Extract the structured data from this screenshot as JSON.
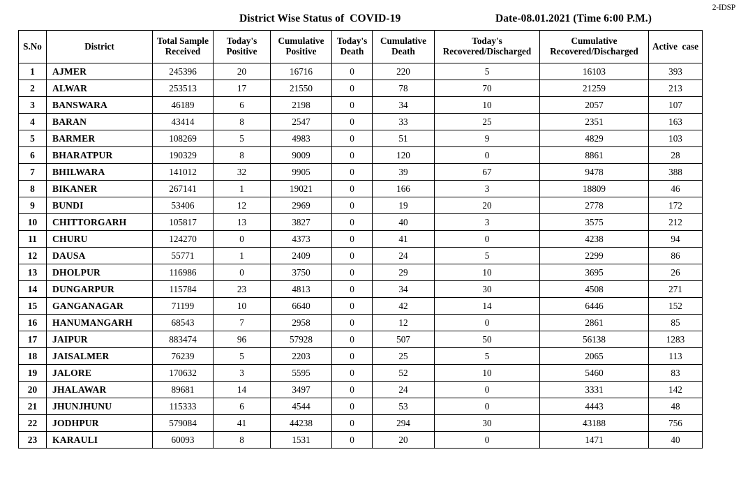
{
  "document": {
    "corner_stamp": "2-IDSP",
    "title": "District Wise Status of  COVID-19",
    "date_line": "Date-08.01.2021 (Time 6:00 P.M.)"
  },
  "table": {
    "columns": [
      {
        "key": "sno",
        "label": "S.No"
      },
      {
        "key": "district",
        "label": "District"
      },
      {
        "key": "total_sample_received",
        "label": "Total Sample\nReceived"
      },
      {
        "key": "todays_positive",
        "label": "Today's\nPositive"
      },
      {
        "key": "cumulative_positive",
        "label": "Cumulative\nPositive"
      },
      {
        "key": "todays_death",
        "label": "Today's\nDeath"
      },
      {
        "key": "cumulative_death",
        "label": "Cumulative\nDeath"
      },
      {
        "key": "todays_recovered",
        "label": "Today's\nRecovered/Discharged"
      },
      {
        "key": "cumulative_recovered",
        "label": "Cumulative\nRecovered/Discharged"
      },
      {
        "key": "active_case",
        "label": "Active  case"
      }
    ],
    "header_lines": {
      "sno": [
        "S.No"
      ],
      "district": [
        "District"
      ],
      "total_sample_received": [
        "Total Sample",
        "Received"
      ],
      "todays_positive": [
        "Today's",
        "Positive"
      ],
      "cumulative_positive": [
        "Cumulative",
        "Positive"
      ],
      "todays_death": [
        "Today's",
        "Death"
      ],
      "cumulative_death": [
        "Cumulative",
        "Death"
      ],
      "todays_recovered": [
        "Today's",
        "Recovered/Discharged"
      ],
      "cumulative_recovered": [
        "Cumulative",
        "Recovered/Discharged"
      ],
      "active_case": [
        "Active  case"
      ]
    },
    "rows": [
      {
        "sno": "1",
        "district": "AJMER",
        "total_sample_received": "245396",
        "todays_positive": "20",
        "cumulative_positive": "16716",
        "todays_death": "0",
        "cumulative_death": "220",
        "todays_recovered": "5",
        "cumulative_recovered": "16103",
        "active_case": "393"
      },
      {
        "sno": "2",
        "district": "ALWAR",
        "total_sample_received": "253513",
        "todays_positive": "17",
        "cumulative_positive": "21550",
        "todays_death": "0",
        "cumulative_death": "78",
        "todays_recovered": "70",
        "cumulative_recovered": "21259",
        "active_case": "213"
      },
      {
        "sno": "3",
        "district": "BANSWARA",
        "total_sample_received": "46189",
        "todays_positive": "6",
        "cumulative_positive": "2198",
        "todays_death": "0",
        "cumulative_death": "34",
        "todays_recovered": "10",
        "cumulative_recovered": "2057",
        "active_case": "107"
      },
      {
        "sno": "4",
        "district": "BARAN",
        "total_sample_received": "43414",
        "todays_positive": "8",
        "cumulative_positive": "2547",
        "todays_death": "0",
        "cumulative_death": "33",
        "todays_recovered": "25",
        "cumulative_recovered": "2351",
        "active_case": "163"
      },
      {
        "sno": "5",
        "district": "BARMER",
        "total_sample_received": "108269",
        "todays_positive": "5",
        "cumulative_positive": "4983",
        "todays_death": "0",
        "cumulative_death": "51",
        "todays_recovered": "9",
        "cumulative_recovered": "4829",
        "active_case": "103"
      },
      {
        "sno": "6",
        "district": "BHARATPUR",
        "total_sample_received": "190329",
        "todays_positive": "8",
        "cumulative_positive": "9009",
        "todays_death": "0",
        "cumulative_death": "120",
        "todays_recovered": "0",
        "cumulative_recovered": "8861",
        "active_case": "28"
      },
      {
        "sno": "7",
        "district": "BHILWARA",
        "total_sample_received": "141012",
        "todays_positive": "32",
        "cumulative_positive": "9905",
        "todays_death": "0",
        "cumulative_death": "39",
        "todays_recovered": "67",
        "cumulative_recovered": "9478",
        "active_case": "388"
      },
      {
        "sno": "8",
        "district": "BIKANER",
        "total_sample_received": "267141",
        "todays_positive": "1",
        "cumulative_positive": "19021",
        "todays_death": "0",
        "cumulative_death": "166",
        "todays_recovered": "3",
        "cumulative_recovered": "18809",
        "active_case": "46"
      },
      {
        "sno": "9",
        "district": "BUNDI",
        "total_sample_received": "53406",
        "todays_positive": "12",
        "cumulative_positive": "2969",
        "todays_death": "0",
        "cumulative_death": "19",
        "todays_recovered": "20",
        "cumulative_recovered": "2778",
        "active_case": "172"
      },
      {
        "sno": "10",
        "district": "CHITTORGARH",
        "total_sample_received": "105817",
        "todays_positive": "13",
        "cumulative_positive": "3827",
        "todays_death": "0",
        "cumulative_death": "40",
        "todays_recovered": "3",
        "cumulative_recovered": "3575",
        "active_case": "212"
      },
      {
        "sno": "11",
        "district": "CHURU",
        "total_sample_received": "124270",
        "todays_positive": "0",
        "cumulative_positive": "4373",
        "todays_death": "0",
        "cumulative_death": "41",
        "todays_recovered": "0",
        "cumulative_recovered": "4238",
        "active_case": "94"
      },
      {
        "sno": "12",
        "district": "DAUSA",
        "total_sample_received": "55771",
        "todays_positive": "1",
        "cumulative_positive": "2409",
        "todays_death": "0",
        "cumulative_death": "24",
        "todays_recovered": "5",
        "cumulative_recovered": "2299",
        "active_case": "86"
      },
      {
        "sno": "13",
        "district": "DHOLPUR",
        "total_sample_received": "116986",
        "todays_positive": "0",
        "cumulative_positive": "3750",
        "todays_death": "0",
        "cumulative_death": "29",
        "todays_recovered": "10",
        "cumulative_recovered": "3695",
        "active_case": "26"
      },
      {
        "sno": "14",
        "district": "DUNGARPUR",
        "total_sample_received": "115784",
        "todays_positive": "23",
        "cumulative_positive": "4813",
        "todays_death": "0",
        "cumulative_death": "34",
        "todays_recovered": "30",
        "cumulative_recovered": "4508",
        "active_case": "271"
      },
      {
        "sno": "15",
        "district": "GANGANAGAR",
        "total_sample_received": "71199",
        "todays_positive": "10",
        "cumulative_positive": "6640",
        "todays_death": "0",
        "cumulative_death": "42",
        "todays_recovered": "14",
        "cumulative_recovered": "6446",
        "active_case": "152"
      },
      {
        "sno": "16",
        "district": "HANUMANGARH",
        "total_sample_received": "68543",
        "todays_positive": "7",
        "cumulative_positive": "2958",
        "todays_death": "0",
        "cumulative_death": "12",
        "todays_recovered": "0",
        "cumulative_recovered": "2861",
        "active_case": "85"
      },
      {
        "sno": "17",
        "district": "JAIPUR",
        "total_sample_received": "883474",
        "todays_positive": "96",
        "cumulative_positive": "57928",
        "todays_death": "0",
        "cumulative_death": "507",
        "todays_recovered": "50",
        "cumulative_recovered": "56138",
        "active_case": "1283"
      },
      {
        "sno": "18",
        "district": "JAISALMER",
        "total_sample_received": "76239",
        "todays_positive": "5",
        "cumulative_positive": "2203",
        "todays_death": "0",
        "cumulative_death": "25",
        "todays_recovered": "5",
        "cumulative_recovered": "2065",
        "active_case": "113"
      },
      {
        "sno": "19",
        "district": "JALORE",
        "total_sample_received": "170632",
        "todays_positive": "3",
        "cumulative_positive": "5595",
        "todays_death": "0",
        "cumulative_death": "52",
        "todays_recovered": "10",
        "cumulative_recovered": "5460",
        "active_case": "83"
      },
      {
        "sno": "20",
        "district": "JHALAWAR",
        "total_sample_received": "89681",
        "todays_positive": "14",
        "cumulative_positive": "3497",
        "todays_death": "0",
        "cumulative_death": "24",
        "todays_recovered": "0",
        "cumulative_recovered": "3331",
        "active_case": "142"
      },
      {
        "sno": "21",
        "district": "JHUNJHUNU",
        "total_sample_received": "115333",
        "todays_positive": "6",
        "cumulative_positive": "4544",
        "todays_death": "0",
        "cumulative_death": "53",
        "todays_recovered": "0",
        "cumulative_recovered": "4443",
        "active_case": "48"
      },
      {
        "sno": "22",
        "district": "JODHPUR",
        "total_sample_received": "579084",
        "todays_positive": "41",
        "cumulative_positive": "44238",
        "todays_death": "0",
        "cumulative_death": "294",
        "todays_recovered": "30",
        "cumulative_recovered": "43188",
        "active_case": "756"
      },
      {
        "sno": "23",
        "district": "KARAULI",
        "total_sample_received": "60093",
        "todays_positive": "8",
        "cumulative_positive": "1531",
        "todays_death": "0",
        "cumulative_death": "20",
        "todays_recovered": "0",
        "cumulative_recovered": "1471",
        "active_case": "40"
      }
    ]
  }
}
